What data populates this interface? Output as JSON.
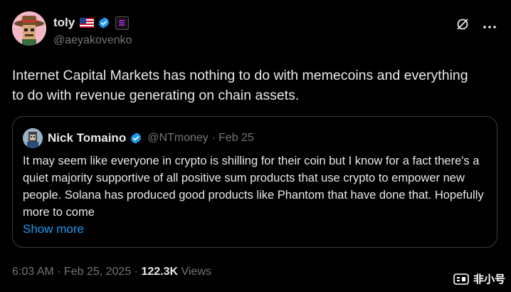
{
  "author": {
    "name": "toly",
    "handle": "@aeyakovenko"
  },
  "tweet": {
    "text": "Internet Capital Markets has nothing to do with memecoins and everything to do with revenue generating on chain assets."
  },
  "quote": {
    "name": "Nick Tomaino",
    "handle_date": "@NTmoney · Feb 25",
    "text": "It may seem like everyone in crypto is shilling for their coin but I know for a fact there's a quiet majority supportive of all positive sum products that use crypto to empower new people. Solana has produced good products like Phantom that have done that.  Hopefully more to come",
    "show_more": "Show more"
  },
  "footer": {
    "timestamp": "6:03 AM · Feb 25, 2025 · ",
    "views_count": "122.3K",
    "views_label": " Views"
  },
  "watermark": {
    "text": "非小号"
  },
  "icons": {
    "flag": "us-flag-icon",
    "verified": "verified-badge-icon",
    "affiliation": "solana-affiliate-icon",
    "grok": "grok-icon",
    "more": "more-icon"
  },
  "colors": {
    "background": "#000000",
    "text": "#e7e9ea",
    "muted": "#71767b",
    "link": "#1d9bf0",
    "verified": "#1d9bf0",
    "border": "#3a3d41"
  }
}
